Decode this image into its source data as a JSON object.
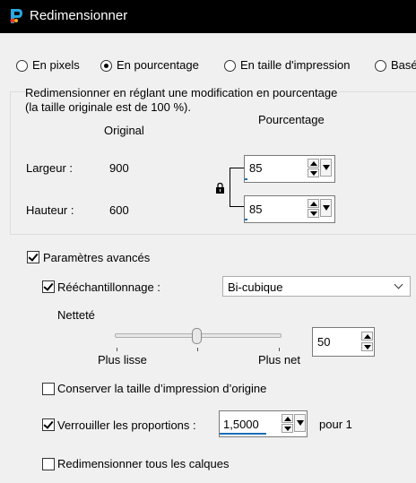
{
  "window": {
    "title": "Redimensionner"
  },
  "modes": [
    {
      "label": "En pixels",
      "selected": false
    },
    {
      "label": "En pourcentage",
      "selected": true
    },
    {
      "label": "En taille d'impression",
      "selected": false
    },
    {
      "label": "Basé",
      "selected": false
    }
  ],
  "percent_group": {
    "description_line1": "Redimensionner en réglant une modification en pourcentage",
    "description_line2": "(la taille originale est de 100 %).",
    "original_header": "Original",
    "percent_header": "Pourcentage",
    "width_label": "Largeur :",
    "width_original": "900",
    "width_percent": "85",
    "height_label": "Hauteur :",
    "height_original": "600",
    "height_percent": "85",
    "lock_icon": "padlock-icon"
  },
  "advanced": {
    "label": "Paramètres avancés",
    "checked": true,
    "resample": {
      "label": "Rééchantillonnage :",
      "checked": true,
      "value": "Bi-cubique"
    },
    "sharpness": {
      "label": "Netteté",
      "value": "50",
      "left_label": "Plus lisse",
      "right_label": "Plus net",
      "level": 0.5
    },
    "keep_print_size": {
      "label": "Conserver la taille d’impression d’origine",
      "checked": false
    },
    "lock_ratio": {
      "label": "Verrouiller les proportions :",
      "checked": true,
      "value": "1,5000",
      "suffix": "pour 1"
    },
    "resize_all_layers": {
      "label": "Redimensionner tous les calques",
      "checked": false
    }
  }
}
